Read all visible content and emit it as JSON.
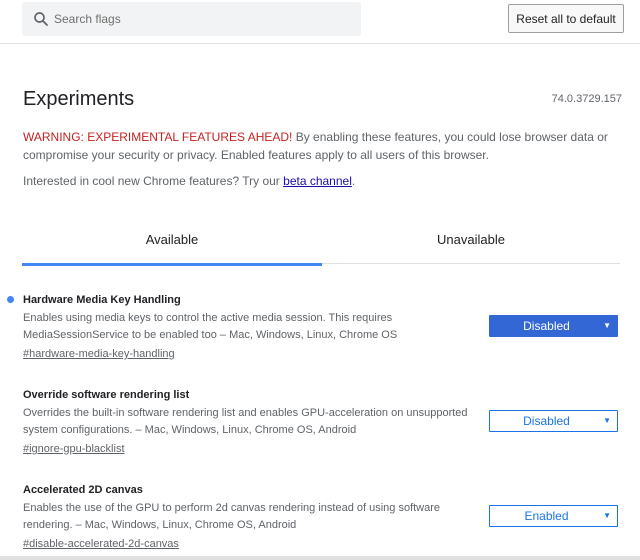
{
  "search": {
    "placeholder": "Search flags"
  },
  "header": {
    "reset_label": "Reset all to default"
  },
  "page": {
    "title": "Experiments",
    "version": "74.0.3729.157",
    "warning_strong": "WARNING: EXPERIMENTAL FEATURES AHEAD!",
    "warning_rest": " By enabling these features, you could lose browser data or compromise your security or privacy. Enabled features apply to all users of this browser.",
    "interest_text": "Interested in cool new Chrome features? Try our ",
    "beta_link": "beta channel",
    "interest_end": "."
  },
  "tabs": [
    {
      "label": "Available",
      "active": true
    },
    {
      "label": "Unavailable",
      "active": false
    }
  ],
  "flags": [
    {
      "title": "Hardware Media Key Handling",
      "description": "Enables using media keys to control the active media session. This requires MediaSessionService to be enabled too – Mac, Windows, Linux, Chrome OS",
      "link": "#hardware-media-key-handling",
      "value": "Disabled",
      "modified": true
    },
    {
      "title": "Override software rendering list",
      "description": "Overrides the built-in software rendering list and enables GPU-acceleration on unsupported system configurations. – Mac, Windows, Linux, Chrome OS, Android",
      "link": "#ignore-gpu-blacklist",
      "value": "Disabled",
      "modified": false
    },
    {
      "title": "Accelerated 2D canvas",
      "description": "Enables the use of the GPU to perform 2d canvas rendering instead of using software rendering. – Mac, Windows, Linux, Chrome OS, Android",
      "link": "#disable-accelerated-2d-canvas",
      "value": "Enabled",
      "modified": false
    }
  ],
  "colors": {
    "accent": "#1a73e8",
    "warning": "#c5221f",
    "active_select": "#3367d6"
  },
  "icons": {
    "search": "search-icon",
    "dropdown": "chevron-down-icon",
    "modified_marker": "dot-icon"
  }
}
